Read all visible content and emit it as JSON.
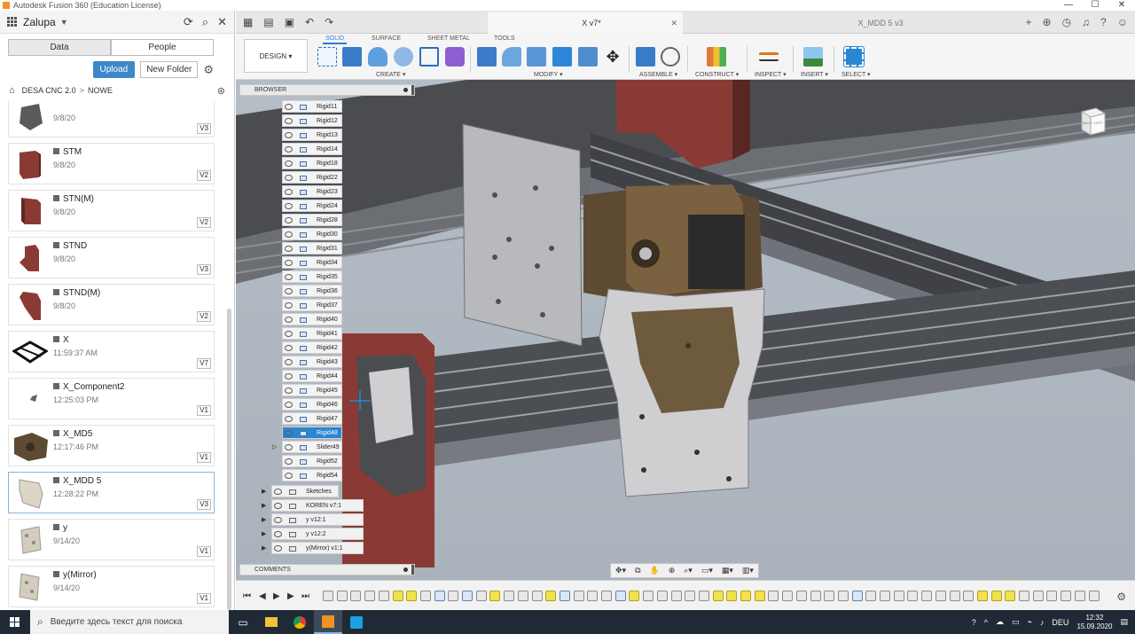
{
  "window": {
    "title": "Autodesk Fusion 360 (Education License)",
    "controls": [
      "—",
      "☐",
      "✕"
    ]
  },
  "data_panel": {
    "project_name": "Zalupa",
    "tabs": [
      {
        "label": "Data"
      },
      {
        "label": "People"
      }
    ],
    "upload_label": "Upload",
    "new_folder_label": "New Folder",
    "breadcrumb": [
      "DESA CNC 2.0",
      "NOWE"
    ],
    "files": [
      {
        "name": "",
        "date": "9/8/20",
        "version": "V3"
      },
      {
        "name": "STM",
        "date": "9/8/20",
        "version": "V2"
      },
      {
        "name": "STN(M)",
        "date": "9/8/20",
        "version": "V2"
      },
      {
        "name": "STND",
        "date": "9/8/20",
        "version": "V3"
      },
      {
        "name": "STND(M)",
        "date": "9/8/20",
        "version": "V2"
      },
      {
        "name": "X",
        "date": "11:59:37 AM",
        "version": "V7"
      },
      {
        "name": "X_Component2",
        "date": "12:25:03 PM",
        "version": "V1"
      },
      {
        "name": "X_MD5",
        "date": "12:17:46 PM",
        "version": "V1"
      },
      {
        "name": "X_MDD 5",
        "date": "12:28:22 PM",
        "version": "V3"
      },
      {
        "name": "y",
        "date": "9/14/20",
        "version": "V1"
      },
      {
        "name": "y(Mirror)",
        "date": "9/14/20",
        "version": "V1"
      }
    ]
  },
  "doc_tabs": [
    {
      "label": "X v7*",
      "active": true
    },
    {
      "label": "X_MDD 5 v3",
      "active": false
    }
  ],
  "toolbar": {
    "workspace": "DESIGN ▾",
    "tabs": [
      "SOLID",
      "SURFACE",
      "SHEET METAL",
      "TOOLS"
    ],
    "groups": [
      "CREATE ▾",
      "MODIFY ▾",
      "ASSEMBLE ▾",
      "CONSTRUCT ▾",
      "INSPECT ▾",
      "INSERT ▾",
      "SELECT ▾"
    ]
  },
  "browser": {
    "title": "BROWSER",
    "joints": [
      "Rigid11",
      "Rigid12",
      "Rigid13",
      "Rigid14",
      "Rigid18",
      "Rigid22",
      "Rigid23",
      "Rigid24",
      "Rigid28",
      "Rigid30",
      "Rigid31",
      "Rigid34",
      "Rigid35",
      "Rigid36",
      "Rigid37",
      "Rigid40",
      "Rigid41",
      "Rigid42",
      "Rigid43",
      "Rigid44",
      "Rigid45",
      "Rigid46",
      "Rigid47",
      "Rigid48",
      "Slider49",
      "Rigid52",
      "Rigid54"
    ],
    "selected_joint": "Rigid48",
    "folders": [
      "Sketches"
    ],
    "components": [
      "KOREN v7:1",
      "y v12:1",
      "y v12:2",
      "y(Mirror) v1:1"
    ]
  },
  "viewcube": {
    "left_label": "LEFT",
    "back_label": "BACK"
  },
  "comments_label": "COMMENTS",
  "taskbar": {
    "search_placeholder": "Введите здесь текст для поиска",
    "language": "DEU",
    "time": "12:32",
    "date": "15.09.2020"
  },
  "colors": {
    "accent": "#3d88c8",
    "selected_row": "#2a86d1",
    "timeline_yellow": "#f2e14b",
    "part_red": "#8a3a34"
  }
}
